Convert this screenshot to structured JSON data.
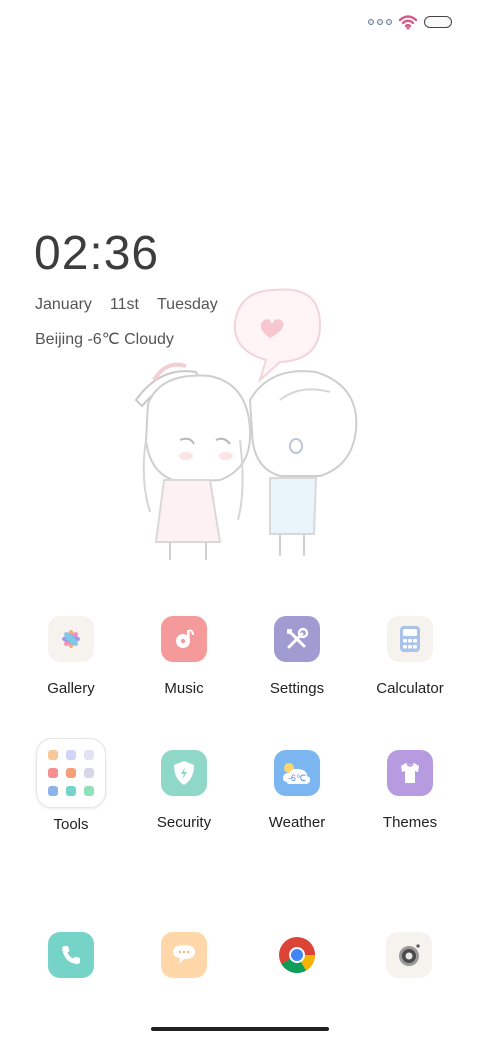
{
  "status": {
    "wifi_icon": "wifi-icon",
    "battery_icon": "battery-icon"
  },
  "lockscreen": {
    "time": "02:36",
    "month": "January",
    "day": "11st",
    "weekday": "Tuesday",
    "weather": "Beijing -6℃ Cloudy"
  },
  "apps": [
    {
      "name": "Gallery",
      "icon": "gallery-icon"
    },
    {
      "name": "Music",
      "icon": "music-icon"
    },
    {
      "name": "Settings",
      "icon": "settings-icon"
    },
    {
      "name": "Calculator",
      "icon": "calculator-icon"
    },
    {
      "name": "Tools",
      "icon": "tools-folder-icon"
    },
    {
      "name": "Security",
      "icon": "security-icon"
    },
    {
      "name": "Weather",
      "icon": "weather-icon",
      "badge": "-6℃"
    },
    {
      "name": "Themes",
      "icon": "themes-icon"
    }
  ],
  "dock": [
    "phone-icon",
    "messages-icon",
    "chrome-icon",
    "camera-icon"
  ],
  "colors": {
    "music": "#f59a9a",
    "settings": "#a09bd0",
    "security": "#8fd8c8",
    "weather": "#7bb6f0",
    "themes": "#b79be0",
    "phone": "#76d3c7",
    "messages": "#ffd7a8",
    "soft_bg": "#f6f3ef"
  }
}
